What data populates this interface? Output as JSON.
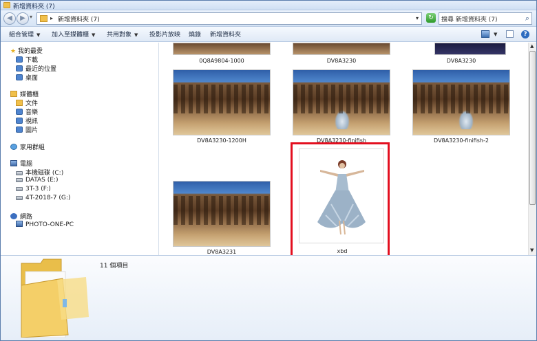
{
  "window": {
    "title": "新增資料夾 (7)"
  },
  "address": {
    "path": "新增資料夾 (7)",
    "search_placeholder": "搜尋 新增資料夾 (7)"
  },
  "toolbar": {
    "organize": "組合管理",
    "add_to_library": "加入至媒體櫃",
    "share": "共用對象",
    "slideshow": "投影片放映",
    "burn": "燒錄",
    "new_folder": "新增資料夾"
  },
  "nav": {
    "favorites": "我的最愛",
    "downloads": "下載",
    "recent": "最近的位置",
    "desktop": "桌面",
    "libraries": "媒體櫃",
    "documents": "文件",
    "music": "音樂",
    "videos": "視訊",
    "pictures": "圖片",
    "homegroup": "家用群組",
    "computer": "電腦",
    "drive_c": "本機磁碟 (C:)",
    "drive_e": "DATAS (E:)",
    "drive_f": "3T-3 (F:)",
    "drive_g": "4T-2018-7 (G:)",
    "network": "網路",
    "pc": "PHOTO-ONE-PC"
  },
  "files": [
    {
      "name": "0Q8A9804-1000"
    },
    {
      "name": "DV8A3230"
    },
    {
      "name": "DV8A3230"
    },
    {
      "name": "DV8A3230-1200H"
    },
    {
      "name": "DV8A3230-finifish"
    },
    {
      "name": "DV8A3230-finifish-2"
    },
    {
      "name": "DV8A3231"
    },
    {
      "name": "xbd"
    }
  ],
  "details": {
    "count": "11 個項目"
  },
  "colors": {
    "selection": "#e30f1f",
    "frame": "#5a7dac"
  }
}
